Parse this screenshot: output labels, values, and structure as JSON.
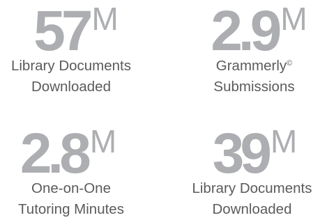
{
  "stats": [
    {
      "value": "57",
      "unit": "M",
      "label_line1": "Library Documents",
      "label_line2": "Downloaded"
    },
    {
      "value": "2.9",
      "unit": "M",
      "label_line1": "Grammerly",
      "label_line1_mark": "©",
      "label_line2": "Submissions"
    },
    {
      "value": "2.8",
      "unit": "M",
      "label_line1": "One-on-One",
      "label_line2": "Tutoring Minutes"
    },
    {
      "value": "39",
      "unit": "M",
      "label_line1": "Library Documents",
      "label_line2": "Downloaded"
    }
  ],
  "colors": {
    "figure": "#adaeb1",
    "label": "#5b5b5b",
    "background": "#ffffff"
  }
}
